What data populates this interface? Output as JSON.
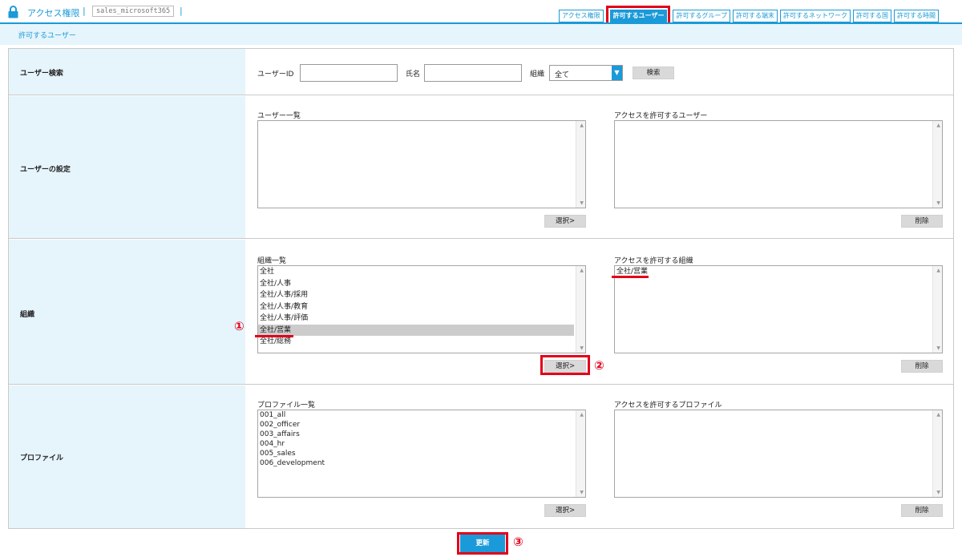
{
  "header": {
    "title": "アクセス権限",
    "separator": "|",
    "account": "sales_microsoft365",
    "tabs": [
      {
        "label": "アクセス権限"
      },
      {
        "label": "許可するユーザー"
      },
      {
        "label": "許可するグループ"
      },
      {
        "label": "許可する端末"
      },
      {
        "label": "許可するネットワーク"
      },
      {
        "label": "許可する国"
      },
      {
        "label": "許可する時間"
      }
    ]
  },
  "subheader": {
    "title": "許可するユーザー"
  },
  "search": {
    "row_label": "ユーザー検索",
    "user_id_label": "ユーザーID",
    "user_id_value": "",
    "name_label": "氏名",
    "name_value": "",
    "org_label": "組織",
    "org_selected": "全て",
    "search_button": "検索"
  },
  "user_settings": {
    "row_label": "ユーザーの設定",
    "list_label": "ユーザー一覧",
    "list_items": [],
    "allowed_label": "アクセスを許可するユーザー",
    "allowed_items": [],
    "select_button": "選択>",
    "delete_button": "削除"
  },
  "organization": {
    "row_label": "組織",
    "list_label": "組織一覧",
    "list_items": [
      "全社",
      "全社/人事",
      "全社/人事/採用",
      "全社/人事/教育",
      "全社/人事/評価",
      "全社/営業",
      "全社/総務"
    ],
    "selected_index": 5,
    "allowed_label": "アクセスを許可する組織",
    "allowed_items": [
      "全社/営業"
    ],
    "select_button": "選択>",
    "delete_button": "削除"
  },
  "profile": {
    "row_label": "プロファイル",
    "list_label": "プロファイル一覧",
    "list_items": [
      "001_all",
      "002_officer",
      "003_affairs",
      "004_hr",
      "005_sales",
      "006_development"
    ],
    "allowed_label": "アクセスを許可するプロファイル",
    "allowed_items": [],
    "select_button": "選択>",
    "delete_button": "削除"
  },
  "update_button": "更新",
  "annotations": {
    "step1": "①",
    "step2": "②",
    "step3": "③"
  },
  "colors": {
    "accent": "#1a9ad8",
    "highlight": "#e2001a",
    "row_head_bg": "#e6f4fc"
  }
}
